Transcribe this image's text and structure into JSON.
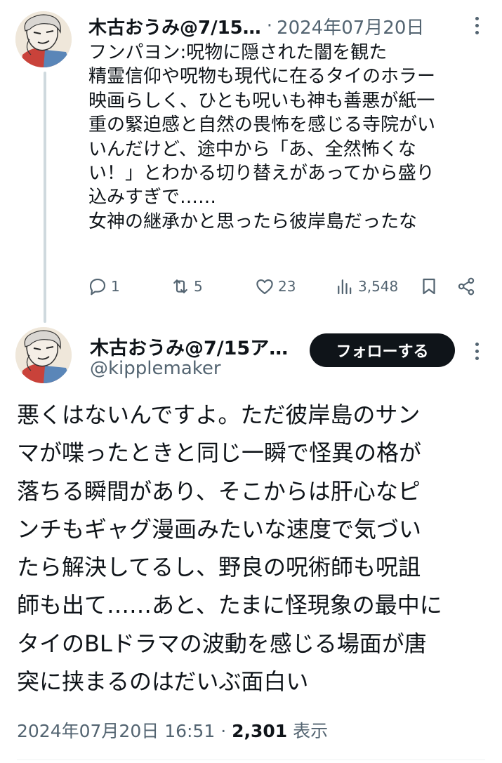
{
  "colors": {
    "text": "#0f1419",
    "secondary": "#536471",
    "follow_bg": "#0f1419",
    "thread_line": "#cfd9de"
  },
  "tweet1": {
    "author_name": "木古おうみ@7/15…",
    "separator": "·",
    "date": "2024年07月20日",
    "body_lines": [
      "フンパヨン:呪物に隠された闇を観た",
      "精霊信仰や呪物も現代に在るタイのホラー",
      "映画らしく、ひとも呪いも神も善悪が紙一",
      "重の緊迫感と自然の畏怖を感じる寺院がい",
      "いんだけど、途中から「あ、全然怖くな",
      "い！」とわかる切り替えがあってから盛り",
      "込みすぎで……",
      "女神の継承かと思ったら彼岸島だったな"
    ],
    "actions": {
      "replies": "1",
      "retweets": "5",
      "likes": "23",
      "views": "3,548"
    },
    "icons": [
      "reply-icon",
      "retweet-icon",
      "like-icon",
      "views-icon",
      "bookmark-icon",
      "share-icon",
      "more-icon"
    ]
  },
  "tweet2": {
    "author_name": "木古おうみ@7/15ア…",
    "handle": "@kipplemaker",
    "follow_label": "フォローする",
    "body_lines": [
      "悪くはないんですよ。ただ彼岸島のサン",
      "マが喋ったときと同じ一瞬で怪異の格が",
      "落ちる瞬間があり、そこからは肝心なピ",
      "ンチもギャグ漫画みたいな速度で気づい",
      "たら解決してるし、野良の呪術師も呪詛",
      "師も出て……あと、たまに怪現象の最中に",
      "タイのBLドラマの波動を感じる場面が唐",
      "突に挟まるのはだいぶ面白い"
    ],
    "timestamp": "2024年07月20日 16:51",
    "separator": "·",
    "view_count": "2,301",
    "view_label": "表示"
  }
}
